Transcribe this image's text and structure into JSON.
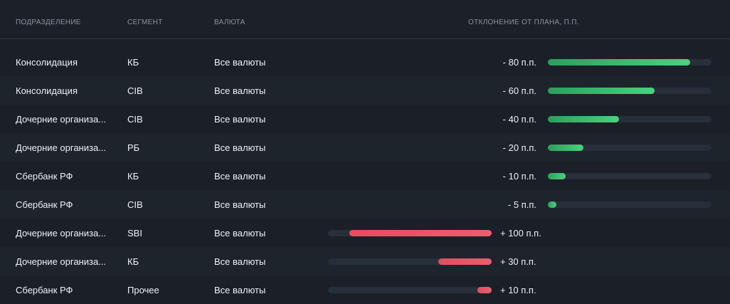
{
  "columns": {
    "division": "Подразделение",
    "segment": "Сегмент",
    "currency": "Валюта",
    "deviation": "Отклонение от плана, п.п."
  },
  "rows": [
    {
      "division": "Консолидация",
      "segment": "КБ",
      "currency": "Все валюты",
      "value_label": "- 80 п.п.",
      "sign": "neg",
      "fill_fraction": 0.87
    },
    {
      "division": "Консолидация",
      "segment": "CIB",
      "currency": "Все валюты",
      "value_label": "- 60 п.п.",
      "sign": "neg",
      "fill_fraction": 0.652
    },
    {
      "division": "Дочерние организа...",
      "segment": "CIB",
      "currency": "Все валюты",
      "value_label": "- 40 п.п.",
      "sign": "neg",
      "fill_fraction": 0.435
    },
    {
      "division": "Дочерние организа...",
      "segment": "РБ",
      "currency": "Все валюты",
      "value_label": "- 20 п.п.",
      "sign": "neg",
      "fill_fraction": 0.217
    },
    {
      "division": "Сбербанк РФ",
      "segment": "КБ",
      "currency": "Все валюты",
      "value_label": "- 10 п.п.",
      "sign": "neg",
      "fill_fraction": 0.109
    },
    {
      "division": "Сбербанк РФ",
      "segment": "CIB",
      "currency": "Все валюты",
      "value_label": "- 5 п.п.",
      "sign": "neg",
      "fill_fraction": 0.054
    },
    {
      "division": "Дочерние организа...",
      "segment": "SBI",
      "currency": "Все валюты",
      "value_label": "+ 100 п.п.",
      "sign": "pos",
      "fill_fraction": 0.87
    },
    {
      "division": "Дочерние организа...",
      "segment": "КБ",
      "currency": "Все валюты",
      "value_label": "+ 30 п.п.",
      "sign": "pos",
      "fill_fraction": 0.326
    },
    {
      "division": "Сбербанк РФ",
      "segment": "Прочее",
      "currency": "Все валюты",
      "value_label": "+ 10 п.п.",
      "sign": "pos",
      "fill_fraction": 0.087
    }
  ],
  "colors": {
    "positive_deviation": "#4cd17f",
    "negative_deviation": "#e8606c",
    "background": "#1b2028"
  }
}
